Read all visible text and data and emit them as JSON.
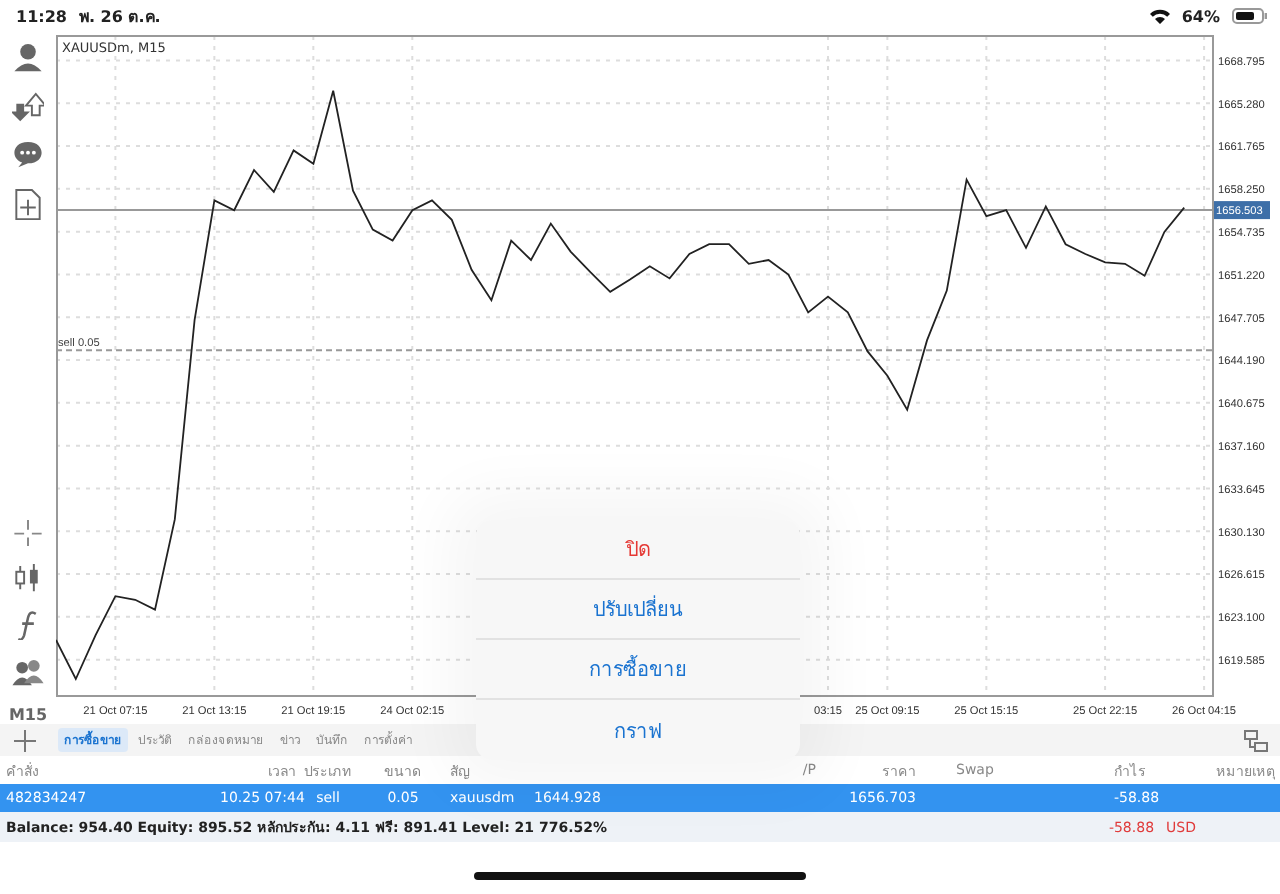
{
  "status_bar": {
    "time": "11:28",
    "date": "พ. 26 ต.ค.",
    "battery": "64%"
  },
  "chart": {
    "title": "XAUUSDm, M15",
    "chart_data": {
      "type": "line",
      "grid": true,
      "categories": [
        null,
        null,
        null,
        "21 Oct 07:15",
        null,
        null,
        null,
        null,
        "21 Oct 13:15",
        null,
        null,
        null,
        null,
        "21 Oct 19:15",
        null,
        null,
        null,
        null,
        "24 Oct 02:15",
        null,
        null,
        null,
        null,
        null,
        null,
        null,
        null,
        null,
        null,
        null,
        null,
        null,
        null,
        null,
        null,
        null,
        null,
        null,
        null,
        "03:15",
        null,
        null,
        "25 Oct 09:15",
        null,
        null,
        null,
        null,
        "25 Oct 15:15",
        null,
        null,
        null,
        null,
        null,
        "25 Oct 22:15",
        null,
        null,
        null,
        null,
        "26 Oct 04:15"
      ],
      "ylim": [
        1616.6,
        1670.8
      ],
      "yticks": [
        {
          "value": 1668.795,
          "label": "1668.795"
        },
        {
          "value": 1665.28,
          "label": "1665.280"
        },
        {
          "value": 1661.765,
          "label": "1661.765"
        },
        {
          "value": 1658.25,
          "label": "1658.250"
        },
        {
          "value": 1654.735,
          "label": "1654.735"
        },
        {
          "value": 1651.22,
          "label": "1651.220"
        },
        {
          "value": 1647.705,
          "label": "1647.705"
        },
        {
          "value": 1644.19,
          "label": "1644.190"
        },
        {
          "value": 1640.675,
          "label": "1640.675"
        },
        {
          "value": 1637.16,
          "label": "1637.160"
        },
        {
          "value": 1633.645,
          "label": "1633.645"
        },
        {
          "value": 1630.13,
          "label": "1630.130"
        },
        {
          "value": 1626.615,
          "label": "1626.615"
        },
        {
          "value": 1623.1,
          "label": "1623.100"
        },
        {
          "value": 1619.585,
          "label": "1619.585"
        }
      ],
      "series": [
        {
          "color": "#222222",
          "values": [
            1621.2,
            1618.0,
            1621.6,
            1624.8,
            1624.5,
            1623.7,
            1631.1,
            1647.5,
            1657.3,
            1656.5,
            1659.8,
            1658.0,
            1661.4,
            1660.3,
            1666.3,
            1658.1,
            1654.9,
            1654.0,
            1656.5,
            1657.3,
            1655.7,
            1651.6,
            1649.1,
            1654.0,
            1652.4,
            1655.4,
            1653.1,
            1651.4,
            1649.8,
            1650.8,
            1651.9,
            1650.9,
            1652.9,
            1653.7,
            1653.7,
            1652.1,
            1652.4,
            1651.2,
            1648.1,
            1649.4,
            1648.1,
            1644.9,
            1642.9,
            1640.1,
            1645.8,
            1649.9,
            1659.0,
            1656.0,
            1656.5,
            1653.4,
            1656.8,
            1653.7,
            1652.9,
            1652.2,
            1652.1,
            1651.1,
            1654.7,
            1656.7,
            null
          ]
        }
      ],
      "ref_lines": [
        {
          "axis": "y",
          "value": 1656.503,
          "label": "1656.503"
        },
        {
          "axis": "y",
          "value": 1645.0,
          "label": "sell 0.05"
        }
      ]
    }
  },
  "timeframe": "M15",
  "menu": [
    {
      "label": "ปิด",
      "kind": "destructive"
    },
    {
      "label": "ปรับเปลี่ยน",
      "kind": "action"
    },
    {
      "label": "การซื้อขาย",
      "kind": "action"
    },
    {
      "label": "กราฟ",
      "kind": "action"
    }
  ],
  "tabs": [
    {
      "label": "การซื้อขาย",
      "selected": true
    },
    {
      "label": "ประวัติ",
      "selected": false
    },
    {
      "label": "กล่องจดหมาย",
      "selected": false
    },
    {
      "label": "ข่าว",
      "selected": false
    },
    {
      "label": "บันทึก",
      "selected": false
    },
    {
      "label": "การตั้งค่า",
      "selected": false
    }
  ],
  "table": {
    "columns": {
      "order": "คำสั่ง",
      "time": "เวลา",
      "type": "ประเภท",
      "volume": "ขนาด",
      "symbol": "สัญ",
      "tp": "/P",
      "price": "ราคา",
      "swap": "Swap",
      "profit": "กำไร",
      "comment": "หมายเหตุ"
    },
    "rows": [
      {
        "selected": true,
        "order": "482834247",
        "time": "10.25 07:44",
        "type": "sell",
        "volume": "0.05",
        "symbol": "xauusdm",
        "open_price": "1644.928",
        "price": "1656.703",
        "profit": "-58.88"
      }
    ]
  },
  "summary": {
    "text": "Balance: 954.40 Equity: 895.52 หลักประกัน: 4.11 ฟรี: 891.41 Level: 21 776.52%",
    "profit": "-58.88",
    "currency": "USD"
  }
}
